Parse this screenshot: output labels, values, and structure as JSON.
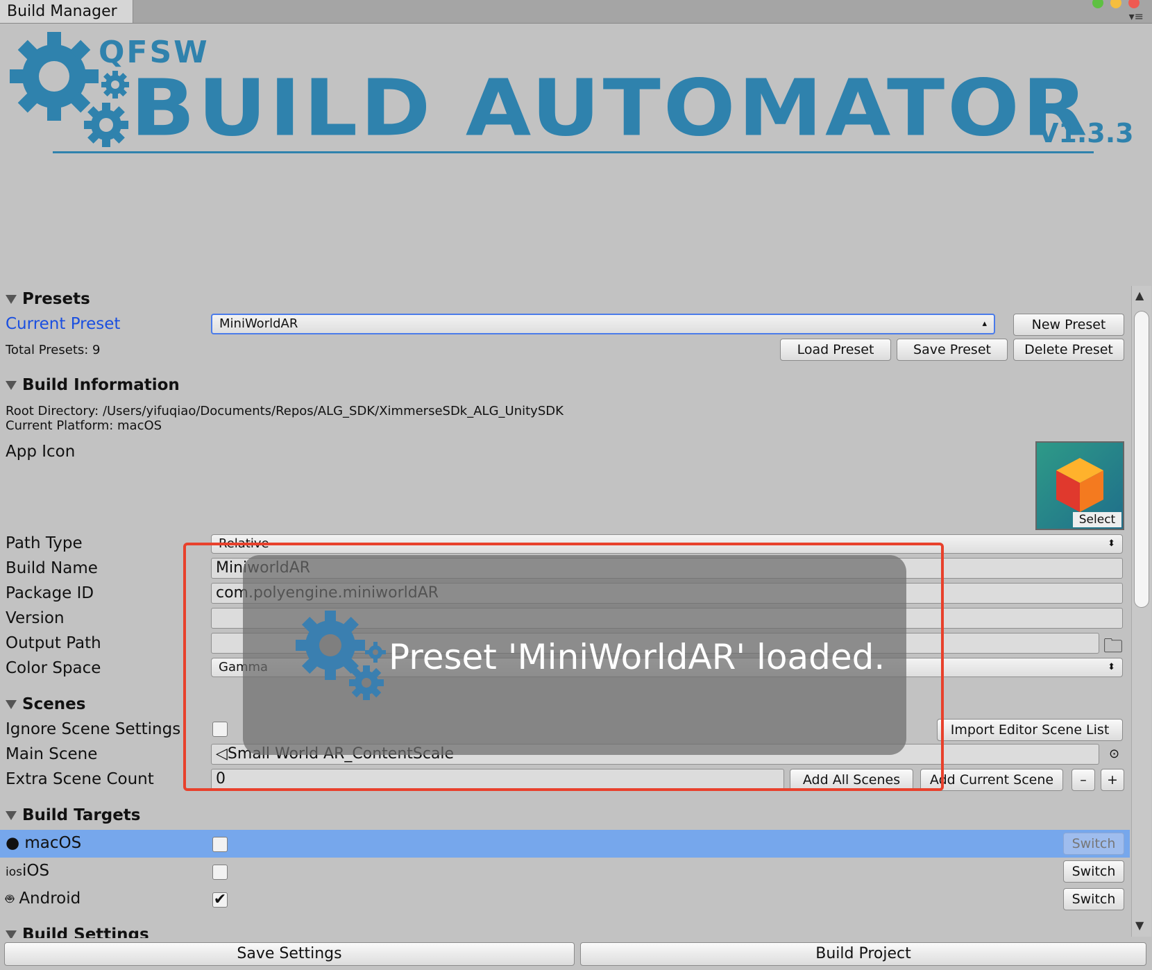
{
  "window": {
    "tab_title": "Build Manager",
    "menu_icon": "≡"
  },
  "header": {
    "brand": "QFSW",
    "title": "BUILD AUTOMATOR",
    "version": "V1.3.3",
    "accent_color": "#2f82ad"
  },
  "presets": {
    "section_title": "Presets",
    "current_label": "Current Preset",
    "current_value": "MiniWorldAR",
    "total_text": "Total Presets: 9",
    "new_button": "New Preset",
    "load_button": "Load Preset",
    "save_button": "Save Preset",
    "delete_button": "Delete Preset"
  },
  "build_info": {
    "section_title": "Build Information",
    "root_directory": "Root Directory: /Users/yifuqiao/Documents/Repos/ALG_SDK/XimmerseSDk_ALG_UnitySDK",
    "current_platform": "Current Platform: macOS",
    "app_icon_label": "App Icon",
    "select_label": "Select",
    "path_type_label": "Path Type",
    "path_type_value": "Relative",
    "build_name_label": "Build Name",
    "build_name_value": "MiniworldAR",
    "package_id_label": "Package ID",
    "package_id_value": "com.polyengine.miniworldAR",
    "version_label": "Version",
    "version_value": "",
    "output_path_label": "Output Path",
    "output_path_value": "",
    "color_space_label": "Color Space",
    "color_space_value": "Gamma"
  },
  "scenes": {
    "section_title": "Scenes",
    "ignore_label": "Ignore Scene Settings",
    "ignore_checked": false,
    "import_button": "Import Editor Scene List",
    "main_scene_label": "Main Scene",
    "main_scene_value": "Small World AR_ContentScale",
    "extra_count_label": "Extra Scene Count",
    "extra_count_value": "0",
    "add_all_button": "Add All Scenes",
    "add_current_button": "Add Current Scene",
    "minus_button": "–",
    "plus_button": "+"
  },
  "build_targets": {
    "section_title": "Build Targets",
    "items": [
      {
        "icon": "apple-icon",
        "icon_text": "",
        "label": "macOS",
        "checked": false,
        "switch": "Switch",
        "selected": true
      },
      {
        "icon": "ios-icon",
        "icon_text": "ios",
        "label": "iOS",
        "checked": false,
        "switch": "Switch",
        "selected": false
      },
      {
        "icon": "android-icon",
        "icon_text": "",
        "label": "Android",
        "checked": true,
        "switch": "Switch",
        "selected": false
      }
    ],
    "selected_color": "#76a7ec"
  },
  "build_settings": {
    "section_title": "Build Settings"
  },
  "footer": {
    "save_settings": "Save Settings",
    "build_project": "Build Project"
  },
  "notification": {
    "message": "Preset 'MiniWorldAR' loaded."
  }
}
